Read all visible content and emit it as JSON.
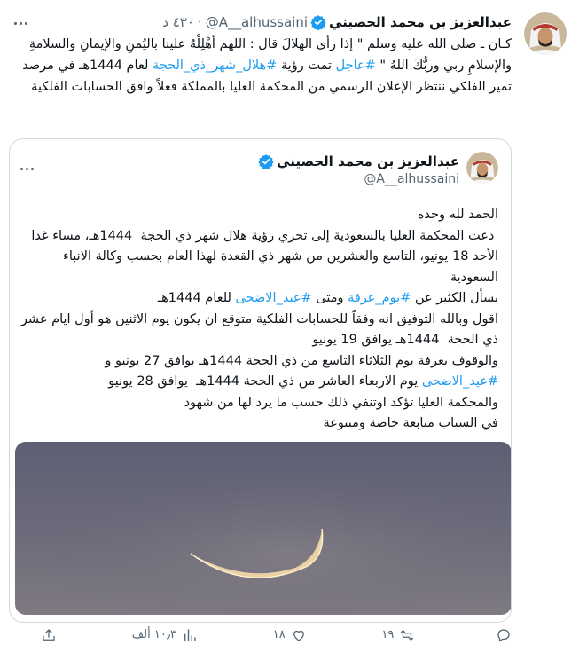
{
  "tweet": {
    "author_name": "عبدالعزيز بن محمد الحصيني",
    "author_handle": "@A__alhussaini",
    "separator": "·",
    "time": "٤٣٠ د",
    "text_parts": [
      "كـان ـ صلى الله عليه وسلم \" إذا رأى الهلالَ قال : اللهم أهْلِلْهُ علينا باليُمنِ والإيمانِ والسلامةِ والإسلامِ ربي وربُّكَ اللهُ \" ",
      "#عاجل",
      " تمت رؤية ",
      "#هلال_شهر_ذي_الحجة",
      " لعام 1444هـ في مرصد  تمير الفلكي ننتظر الإعلان الرسمي من المحكمة العليا بالمملكة فعلاً وافق الحسابات الفلكية"
    ]
  },
  "quote": {
    "author_name": "عبدالعزيز بن محمد الحصيني",
    "author_handle": "@A__alhussaini",
    "lines": [
      "الحمد لله وحده",
      " دعت المحكمة العليا بالسعودية إلى تحري رؤية هلال شهر ذي الحجة  1444هـ، مساء غدا الأحد 18 يونيو، التاسع والعشرين من شهر ذي القعدة لهذا العام بحسب وكالة الانباء السعودية",
      "يسأل الكثير عن ",
      "#يوم_عرفة",
      " ومتى ",
      "#عيد_الاضحى",
      " للعام 1444هـ",
      "اقول وبالله التوفيق انه وفقاً للحسابات الفلكية متوقع ان يكون يوم الاثنين هو أول ايام عشر ذي الحجة  1444هـ يوافق 19 يونيو",
      "والوقوف بعرفة يوم الثلاثاء التاسع من ذي الحجة 1444هـ يوافق 27 يونيو و ",
      "#عيد_الاضحى",
      " يوم الاربعاء العاشر من ذي الحجة 1444هـ  يوافق 28 يونيو",
      "والمحكمة العليا تؤكد اوتنفي ذلك حسب ما يرد لها من شهود",
      "في السناب متابعة خاصة ومتنوعة"
    ]
  },
  "actions": {
    "reply_count": "",
    "retweet_count": "١٩",
    "like_count": "١٨",
    "views_count": "١٠٫٣ ألف",
    "share_count": ""
  },
  "colors": {
    "accent": "#1d9bf0",
    "text": "#0f1419",
    "muted": "#536471",
    "border": "#cfd9de"
  }
}
